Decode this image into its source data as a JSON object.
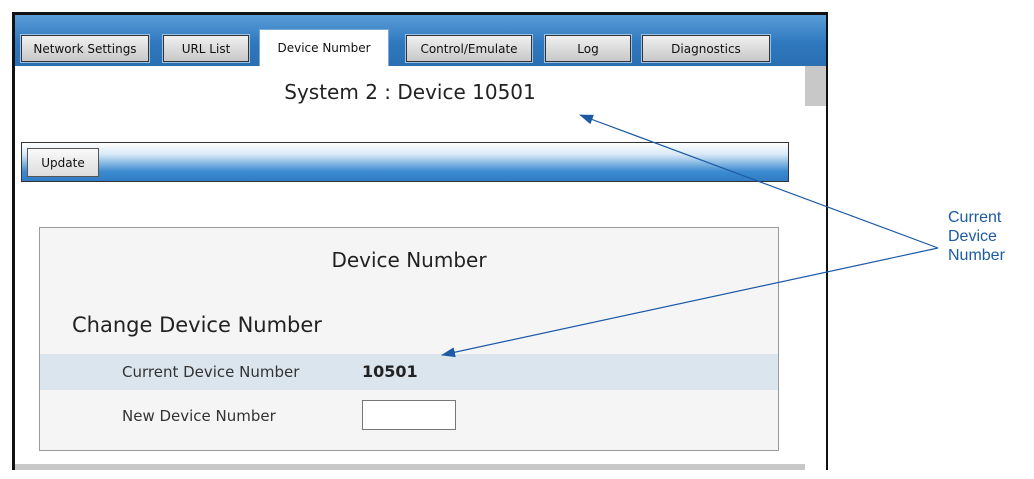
{
  "tabs": [
    {
      "label": "Network Settings",
      "active": false
    },
    {
      "label": "URL List",
      "active": false
    },
    {
      "label": "Device Number",
      "active": true
    },
    {
      "label": "Control/Emulate",
      "active": false
    },
    {
      "label": "Log",
      "active": false
    },
    {
      "label": "Diagnostics",
      "active": false
    }
  ],
  "page": {
    "title": "System 2 : Device 10501"
  },
  "toolbar": {
    "update_label": "Update"
  },
  "panel": {
    "title": "Device Number",
    "section_title": "Change Device Number",
    "current_label": "Current Device Number",
    "current_value": "10501",
    "new_label": "New Device Number",
    "new_value": ""
  },
  "annotation": {
    "line1": "Current",
    "line2": "Device",
    "line3": "Number"
  },
  "colors": {
    "tab_bar": "#2f78bf",
    "annotation": "#1c5aa6",
    "row_highlight": "#dbe5ee"
  }
}
